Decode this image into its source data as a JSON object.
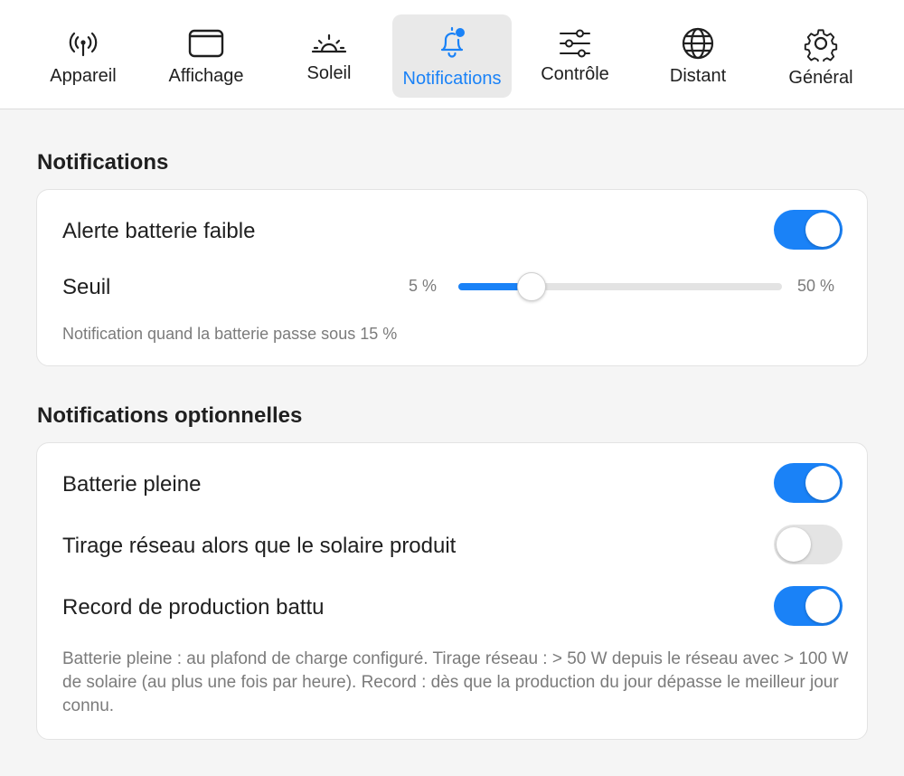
{
  "toolbar": {
    "tabs": [
      {
        "label": "Appareil",
        "icon": "antenna-icon"
      },
      {
        "label": "Affichage",
        "icon": "window-icon"
      },
      {
        "label": "Soleil",
        "icon": "sunrise-icon"
      },
      {
        "label": "Notifications",
        "icon": "bell-badge-icon"
      },
      {
        "label": "Contrôle",
        "icon": "sliders-icon"
      },
      {
        "label": "Distant",
        "icon": "globe-icon"
      },
      {
        "label": "Général",
        "icon": "gear-icon"
      }
    ],
    "active_index": 3
  },
  "notifications": {
    "title": "Notifications",
    "low_battery_label": "Alerte batterie faible",
    "low_battery_enabled": true,
    "threshold_label": "Seuil",
    "threshold_min": "5 %",
    "threshold_max": "50 %",
    "threshold_value_pct": 15,
    "threshold_note_prefix": "Notification quand la batterie passe sous",
    "threshold_note_value": "15 %"
  },
  "optional": {
    "title": "Notifications optionnelles",
    "items": [
      {
        "label": "Batterie pleine",
        "enabled": true
      },
      {
        "label": "Tirage réseau alors que le solaire produit",
        "enabled": false
      },
      {
        "label": "Record de production battu",
        "enabled": true
      }
    ],
    "help": "Batterie pleine : au plafond de charge configuré. Tirage réseau : > 50 W depuis le réseau avec > 100 W de solaire (au plus une fois par heure). Record : dès que la production du jour dépasse le meilleur jour connu."
  },
  "colors": {
    "accent": "#1a82f7",
    "toggle_off": "#e4e4e4",
    "secondary_text": "#7b7b7b"
  }
}
